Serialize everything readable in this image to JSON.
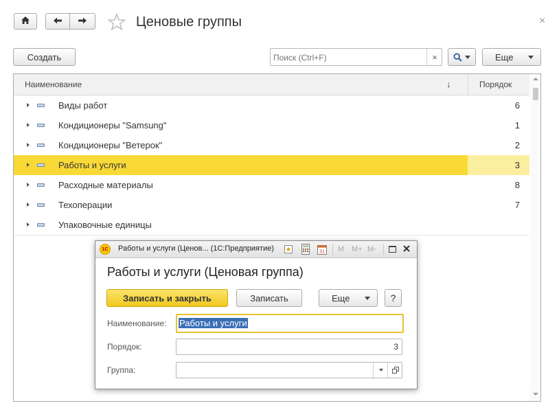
{
  "window": {
    "title": "Ценовые группы",
    "close_glyph": "×"
  },
  "toolbar": {
    "create_label": "Создать",
    "search_placeholder": "Поиск (Ctrl+F)",
    "search_clear": "×",
    "more_label": "Еще"
  },
  "grid": {
    "columns": [
      "Наименование",
      "Порядок"
    ],
    "sort_indicator": "↓",
    "rows": [
      {
        "name": "Виды работ",
        "order": "6"
      },
      {
        "name": "Кондиционеры \"Samsung\"",
        "order": "1"
      },
      {
        "name": "Кондиционеры \"Ветерок\"",
        "order": "2"
      },
      {
        "name": "Работы и услуги",
        "order": "3",
        "selected": true
      },
      {
        "name": "Расходные материалы",
        "order": "8"
      },
      {
        "name": "Техоперации",
        "order": "7"
      },
      {
        "name": "Упаковочные единицы",
        "order": ""
      }
    ]
  },
  "dialog": {
    "window_title": "Работы и услуги (Ценов... (1С:Предприятие)",
    "app_icon_text": "1С",
    "memory_buttons": [
      "M",
      "M+",
      "M-"
    ],
    "heading": "Работы и услуги (Ценовая группа)",
    "save_close_label": "Записать и закрыть",
    "save_label": "Записать",
    "more_label": "Еще",
    "help_label": "?",
    "name_label": "Наименование:",
    "name_value": "Работы и услуги",
    "order_label": "Порядок:",
    "order_value": "3",
    "group_label": "Группа:",
    "group_value": ""
  },
  "colors": {
    "selected_row": "#f8d936",
    "selected_order_cell": "#fbef9f",
    "primary_button": "#f8d936",
    "focus_border": "#e8c22a"
  }
}
